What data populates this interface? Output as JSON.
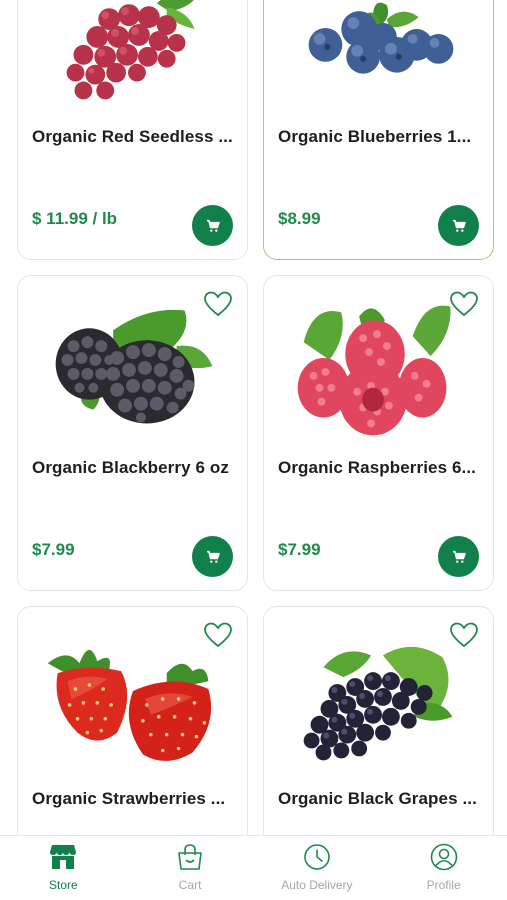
{
  "products": [
    {
      "name": "Organic Red Seedless ...",
      "price": "$ 11.99 / lb",
      "image": "red-grapes",
      "selected": false,
      "favorite_icon": "heart-outline-icon"
    },
    {
      "name": "Organic Blueberries 1...",
      "price": "$8.99",
      "image": "blueberries",
      "selected": true,
      "favorite_icon": "heart-outline-icon"
    },
    {
      "name": "Organic Blackberry 6 oz",
      "price": "$7.99",
      "image": "blackberries",
      "selected": false,
      "favorite_icon": "heart-outline-icon"
    },
    {
      "name": "Organic Raspberries 6...",
      "price": "$7.99",
      "image": "raspberries",
      "selected": false,
      "favorite_icon": "heart-outline-icon"
    },
    {
      "name": "Organic Strawberries ...",
      "price": "",
      "image": "strawberries",
      "selected": false,
      "favorite_icon": "heart-outline-icon"
    },
    {
      "name": "Organic Black Grapes ...",
      "price": "",
      "image": "black-grapes",
      "selected": false,
      "favorite_icon": "heart-outline-icon"
    }
  ],
  "nav": {
    "items": [
      {
        "label": "Store",
        "icon": "store-icon",
        "active": true
      },
      {
        "label": "Cart",
        "icon": "shopping-bag-icon",
        "active": false
      },
      {
        "label": "Auto Delivery",
        "icon": "clock-icon",
        "active": false
      },
      {
        "label": "Profile",
        "icon": "profile-icon",
        "active": false
      }
    ]
  },
  "colors": {
    "accent": "#12804a",
    "price": "#1f8a4c",
    "inactive": "#a6a6a6",
    "selected_border": "#a8c98a"
  }
}
